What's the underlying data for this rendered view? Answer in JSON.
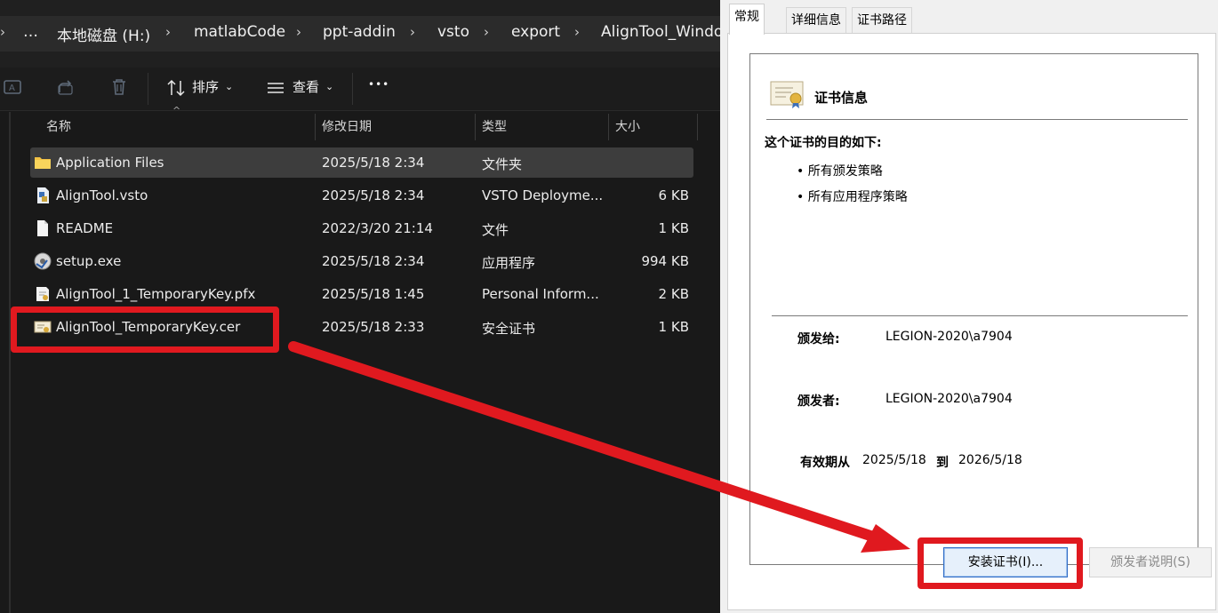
{
  "explorer": {
    "breadcrumb": [
      "…",
      "本地磁盘 (H:)",
      "matlabCode",
      "ppt-addin",
      "vsto",
      "export",
      "AlignTool_Windo"
    ],
    "toolbar": {
      "sort_label": "排序",
      "view_label": "查看",
      "more_label": "•••"
    },
    "columns": {
      "name": "名称",
      "date": "修改日期",
      "type": "类型",
      "size": "大小"
    },
    "files": [
      {
        "name": "Application Files",
        "date": "2025/5/18 2:34",
        "type": "文件夹",
        "size": "",
        "icon": "folder-icon"
      },
      {
        "name": "AlignTool.vsto",
        "date": "2025/5/18 2:34",
        "type": "VSTO Deployme...",
        "size": "6 KB",
        "icon": "vsto-file-icon"
      },
      {
        "name": "README",
        "date": "2022/3/20 21:14",
        "type": "文件",
        "size": "1 KB",
        "icon": "document-icon"
      },
      {
        "name": "setup.exe",
        "date": "2025/5/18 2:34",
        "type": "应用程序",
        "size": "994 KB",
        "icon": "setup-exe-icon"
      },
      {
        "name": "AlignTool_1_TemporaryKey.pfx",
        "date": "2025/5/18 1:45",
        "type": "Personal Inform...",
        "size": "2 KB",
        "icon": "pfx-file-icon"
      },
      {
        "name": "AlignTool_TemporaryKey.cer",
        "date": "2025/5/18 2:33",
        "type": "安全证书",
        "size": "1 KB",
        "icon": "certificate-file-icon"
      }
    ]
  },
  "dialog": {
    "tabs": [
      "常规",
      "详细信息",
      "证书路径"
    ],
    "cert_title": "证书信息",
    "purpose_heading": "这个证书的目的如下:",
    "purposes": [
      "• 所有颁发策略",
      "• 所有应用程序策略"
    ],
    "issued_to_label": "颁发给:",
    "issued_to": "LEGION-2020\\a7904",
    "issued_by_label": "颁发者:",
    "issued_by": "LEGION-2020\\a7904",
    "valid_from_label": "有效期从",
    "valid_from": "2025/5/18",
    "valid_to_label": "到",
    "valid_to": "2026/5/18",
    "install_button": "安装证书(I)...",
    "issuer_statement_button": "颁发者说明(S)"
  },
  "colors": {
    "annotation_red": "#e0191f",
    "explorer_bg": "#191919",
    "dialog_bg": "#f0f0f0"
  }
}
